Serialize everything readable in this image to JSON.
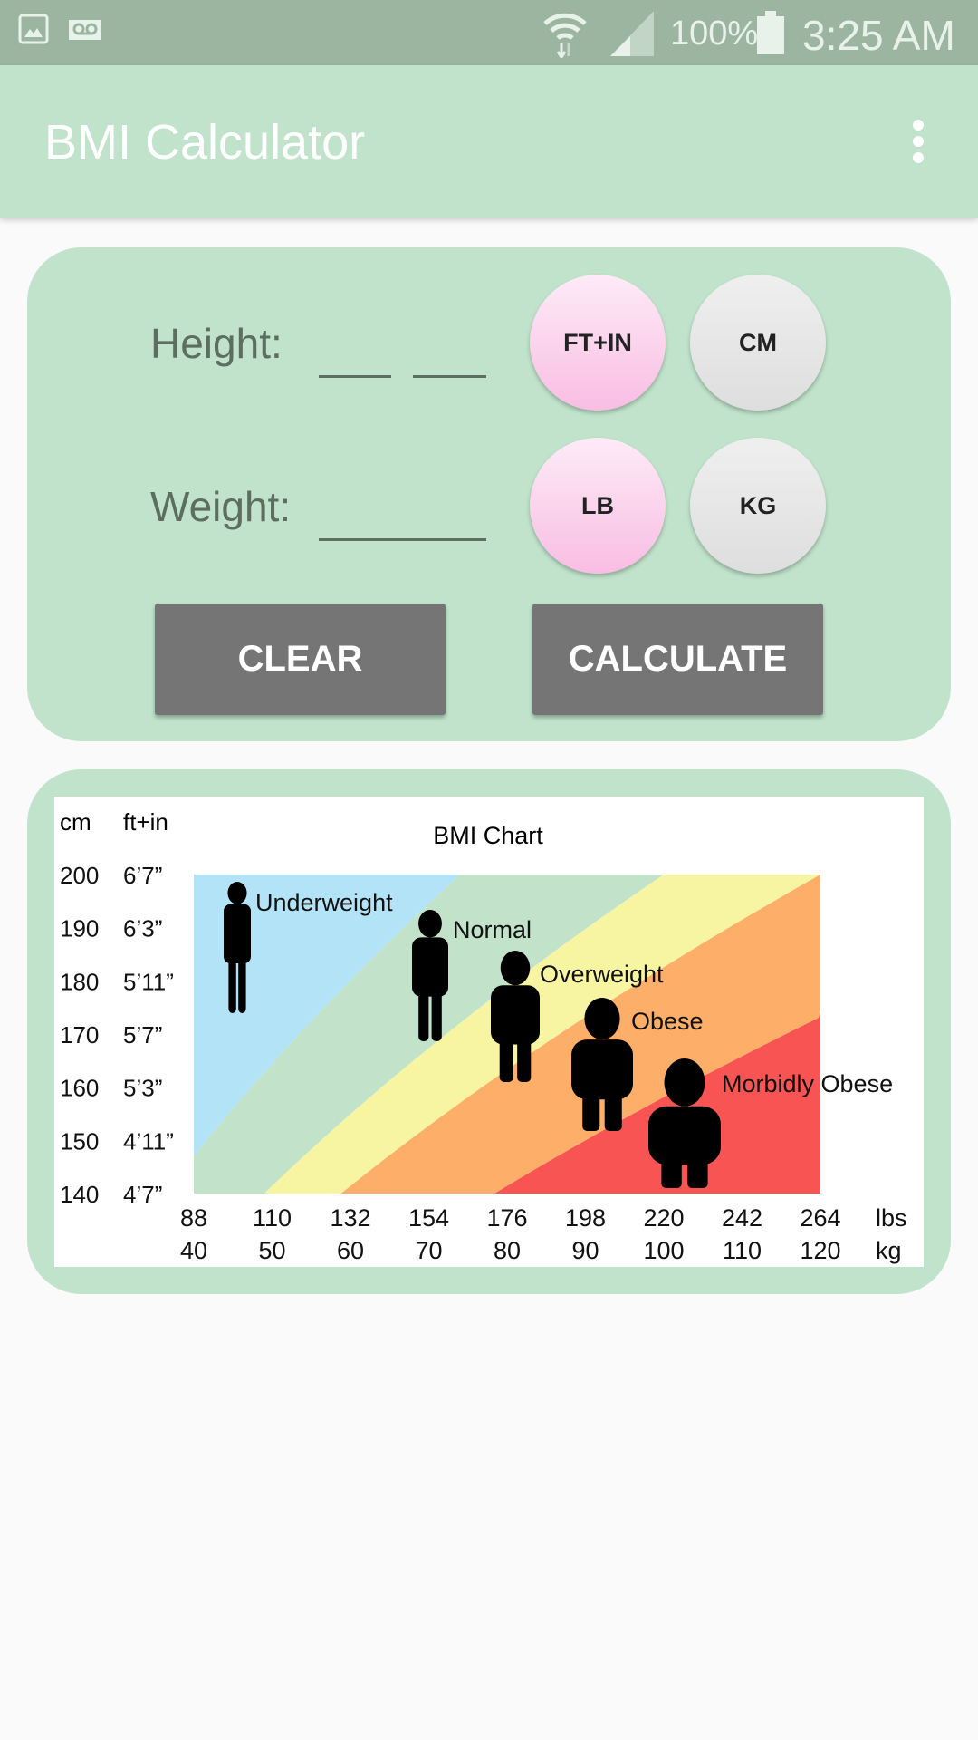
{
  "status_bar": {
    "battery": "100%",
    "time": "3:25 AM",
    "icons": [
      "gallery-icon",
      "voicemail-icon",
      "wifi-icon",
      "signal-icon",
      "battery-icon"
    ]
  },
  "app_bar": {
    "title": "BMI Calculator",
    "menu_icon": "more-vert-icon"
  },
  "form": {
    "height_label": "Height:",
    "height_ft_value": "",
    "height_in_value": "",
    "weight_label": "Weight:",
    "weight_value": "",
    "unit_ft_in": "FT+IN",
    "unit_cm": "CM",
    "unit_lb": "LB",
    "unit_kg": "KG",
    "clear_label": "CLEAR",
    "calculate_label": "CALCULATE",
    "selected_color": "#f9c8e8",
    "unselected_color": "#e6e6e6",
    "button_color": "#757575"
  },
  "chart_data": {
    "type": "area",
    "title": "BMI Chart",
    "y_unit_labels": [
      "cm",
      "ft+in"
    ],
    "y_ticks_cm": [
      "200",
      "190",
      "180",
      "170",
      "160",
      "150",
      "140"
    ],
    "y_ticks_ftin": [
      "6’7”",
      "6’3”",
      "5’11”",
      "5’7”",
      "5’3”",
      "4’11”",
      "4’7”"
    ],
    "x_ticks_lbs": [
      "88",
      "110",
      "132",
      "154",
      "176",
      "198",
      "220",
      "242",
      "264"
    ],
    "x_ticks_kg": [
      "40",
      "50",
      "60",
      "70",
      "80",
      "90",
      "100",
      "110",
      "120"
    ],
    "x_unit_lbs": "lbs",
    "x_unit_kg": "kg",
    "xlim_kg": [
      40,
      120
    ],
    "ylim_cm": [
      140,
      200
    ],
    "categories": [
      {
        "name": "Underweight",
        "bmi_min": 0,
        "bmi_max": 18.5,
        "color": "#b3e3f7"
      },
      {
        "name": "Normal",
        "bmi_min": 18.5,
        "bmi_max": 25,
        "color": "#c2e2c9"
      },
      {
        "name": "Overweight",
        "bmi_min": 25,
        "bmi_max": 30,
        "color": "#f8f5a2"
      },
      {
        "name": "Obese",
        "bmi_min": 30,
        "bmi_max": 40,
        "color": "#fdae68"
      },
      {
        "name": "Morbidly Obese",
        "bmi_min": 40,
        "bmi_max": 100,
        "color": "#f85454"
      }
    ]
  }
}
